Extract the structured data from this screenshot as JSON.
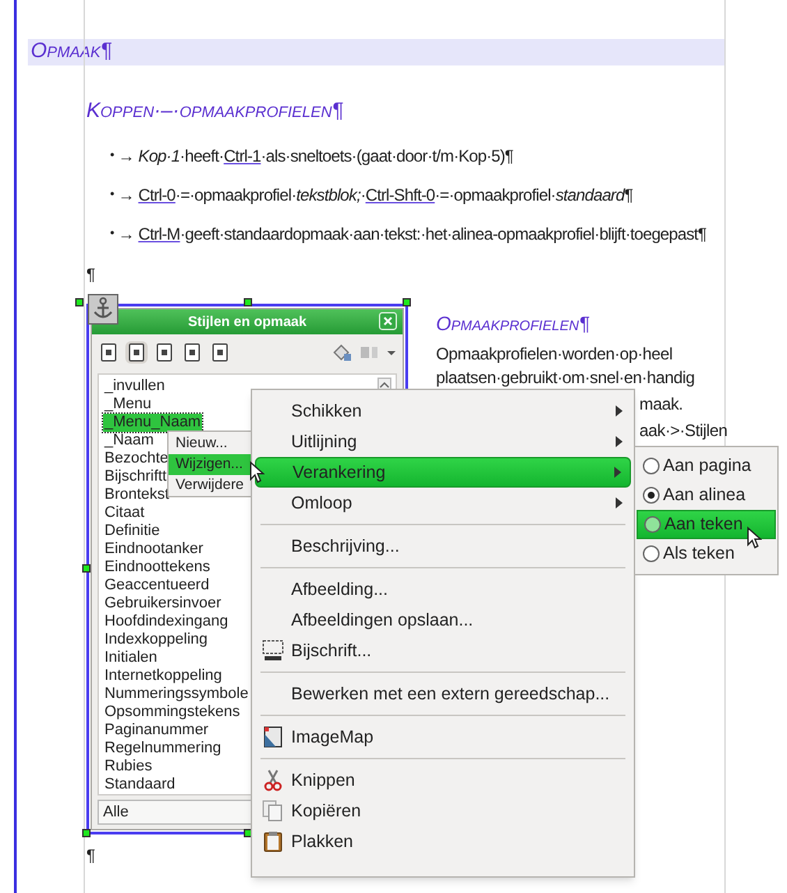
{
  "document": {
    "heading": "Opmaak¶",
    "subheading": "Koppen·–·opmaakprofielen¶",
    "bullets": [
      {
        "marker": "•",
        "tab": "→",
        "segments": [
          {
            "kind": "italic",
            "text": "Kop·1"
          },
          {
            "kind": "plain",
            "text": "·heeft·"
          },
          {
            "kind": "underline",
            "text": "Ctrl-1"
          },
          {
            "kind": "plain",
            "text": "·als·sneltoets·(gaat·door·t/m·Kop·5)¶"
          }
        ]
      },
      {
        "marker": "•",
        "tab": "→",
        "segments": [
          {
            "kind": "underline",
            "text": "Ctrl-0"
          },
          {
            "kind": "plain",
            "text": "·=·opmaakprofiel·"
          },
          {
            "kind": "italic",
            "text": "tekstblok;"
          },
          {
            "kind": "plain",
            "text": "·"
          },
          {
            "kind": "underline",
            "text": "Ctrl-Shft-0"
          },
          {
            "kind": "plain",
            "text": "·=·opmaakprofiel·"
          },
          {
            "kind": "italic",
            "text": "standaard"
          },
          {
            "kind": "plain",
            "text": "¶"
          }
        ]
      },
      {
        "marker": "•",
        "tab": "→",
        "segments": [
          {
            "kind": "underline",
            "text": "Ctrl-M"
          },
          {
            "kind": "plain",
            "text": "·geeft·standaardopmaak·aan·tekst:·het·alinea-opmaakprofiel·blijft·toegepast¶"
          }
        ]
      }
    ],
    "empty_paragraph": "¶",
    "empty_paragraph_after": "¶",
    "side_heading": "Opmaakprofielen¶",
    "side_lines": [
      {
        "kind": "full",
        "text": "Opmaakprofielen·worden·op·heel"
      },
      {
        "kind": "full",
        "text": "plaatsen·gebruikt·om·snel·en·handig"
      },
      {
        "kind": "tail",
        "text": "maak."
      },
      {
        "kind": "tail",
        "text": "aak·>·Stijlen"
      }
    ]
  },
  "styles_panel": {
    "title": "Stijlen en opmaak",
    "items": [
      {
        "label": "_invullen",
        "selected": false
      },
      {
        "label": "_Menu",
        "selected": false
      },
      {
        "label": "_Menu_Naam",
        "selected": true
      },
      {
        "label": "_Naam",
        "selected": false
      },
      {
        "label": "Bezochte",
        "selected": false
      },
      {
        "label": "Bijschriftt",
        "selected": false
      },
      {
        "label": "Brontekst",
        "selected": false
      },
      {
        "label": "Citaat",
        "selected": false
      },
      {
        "label": "Definitie",
        "selected": false
      },
      {
        "label": "Eindnootanker",
        "selected": false
      },
      {
        "label": "Eindnoottekens",
        "selected": false
      },
      {
        "label": "Geaccentueerd",
        "selected": false
      },
      {
        "label": "Gebruikersinvoer",
        "selected": false
      },
      {
        "label": "Hoofdindexingang",
        "selected": false
      },
      {
        "label": "Indexkoppeling",
        "selected": false
      },
      {
        "label": "Initialen",
        "selected": false
      },
      {
        "label": "Internetkoppeling",
        "selected": false
      },
      {
        "label": "Nummeringssymbole",
        "selected": false
      },
      {
        "label": "Opsommingstekens",
        "selected": false
      },
      {
        "label": "Paginanummer",
        "selected": false
      },
      {
        "label": "Regelnummering",
        "selected": false
      },
      {
        "label": "Rubies",
        "selected": false
      },
      {
        "label": "Standaard",
        "selected": false
      }
    ],
    "filter": "Alle"
  },
  "style_menu": [
    {
      "label": "Nieuw...",
      "selected": false
    },
    {
      "label": "Wijzigen...",
      "selected": true
    },
    {
      "label": "Verwijdere",
      "selected": false
    }
  ],
  "context_menu": [
    {
      "kind": "submenu",
      "label": "Schikken",
      "selected": false
    },
    {
      "kind": "submenu",
      "label": "Uitlijning",
      "selected": false
    },
    {
      "kind": "submenu",
      "label": "Verankering",
      "selected": true
    },
    {
      "kind": "submenu",
      "label": "Omloop",
      "selected": false
    },
    {
      "kind": "separator"
    },
    {
      "kind": "item",
      "label": "Beschrijving...",
      "selected": false
    },
    {
      "kind": "separator"
    },
    {
      "kind": "item",
      "label": "Afbeelding...",
      "selected": false
    },
    {
      "kind": "item",
      "label": "Afbeeldingen opslaan...",
      "selected": false
    },
    {
      "kind": "caption",
      "label": "Bijschrift...",
      "selected": false
    },
    {
      "kind": "separator"
    },
    {
      "kind": "item",
      "label": "Bewerken met een extern gereedschap...",
      "selected": false
    },
    {
      "kind": "separator"
    },
    {
      "kind": "imagemap",
      "label": "ImageMap",
      "selected": false
    },
    {
      "kind": "separator"
    },
    {
      "kind": "cut",
      "label": "Knippen",
      "selected": false
    },
    {
      "kind": "copy",
      "label": "Kopiëren",
      "selected": false
    },
    {
      "kind": "paste",
      "label": "Plakken",
      "selected": false
    }
  ],
  "anchor_submenu": [
    {
      "label": "Aan pagina",
      "checked": false,
      "selected": false
    },
    {
      "label": "Aan alinea",
      "checked": true,
      "selected": false
    },
    {
      "label": "Aan teken",
      "checked": false,
      "selected": true
    },
    {
      "label": "Als teken",
      "checked": false,
      "selected": false
    }
  ]
}
